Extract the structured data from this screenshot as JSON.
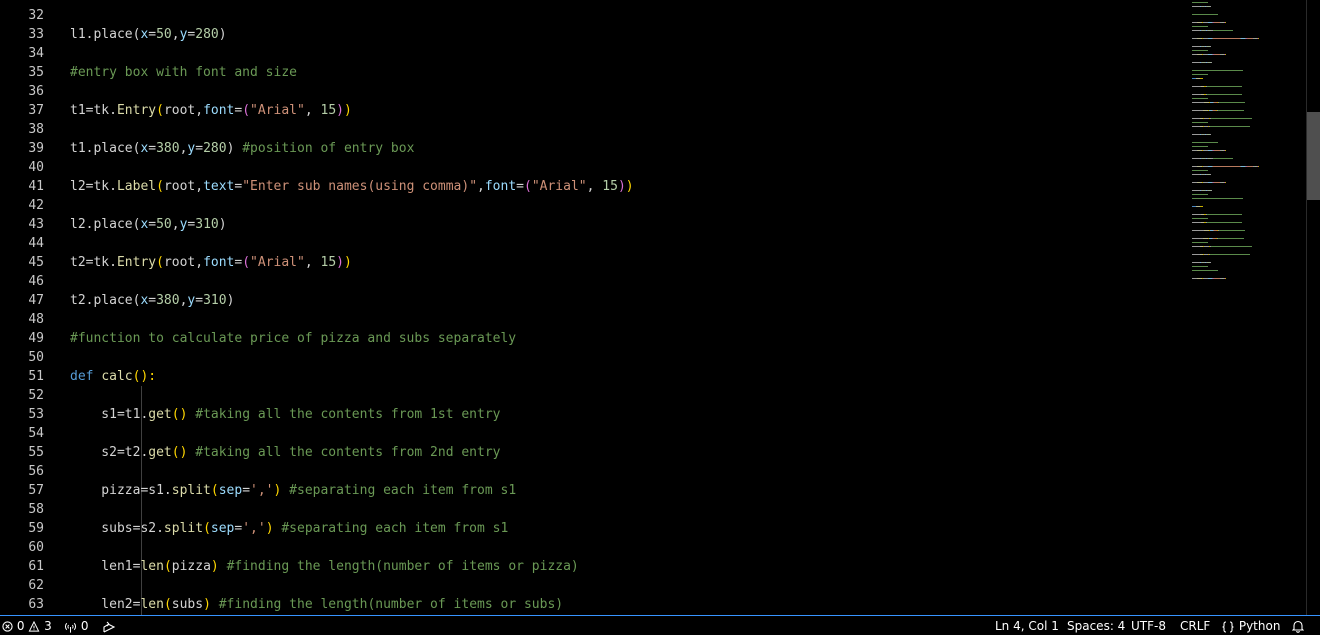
{
  "editor": {
    "line_numbers": [
      "32",
      "33",
      "34",
      "35",
      "36",
      "37",
      "38",
      "39",
      "40",
      "41",
      "42",
      "43",
      "44",
      "45",
      "46",
      "47",
      "48",
      "49",
      "50",
      "51",
      "52",
      "53",
      "54",
      "55",
      "56",
      "57",
      "58",
      "59",
      "60",
      "61",
      "62",
      "63"
    ],
    "lines": [
      [],
      [
        {
          "t": "l1.place(",
          "c": "tx"
        },
        {
          "t": "x",
          "c": "pa"
        },
        {
          "t": "=",
          "c": "tx"
        },
        {
          "t": "50",
          "c": "num"
        },
        {
          "t": ",",
          "c": "tx"
        },
        {
          "t": "y",
          "c": "pa"
        },
        {
          "t": "=",
          "c": "tx"
        },
        {
          "t": "280",
          "c": "num"
        },
        {
          "t": ")",
          "c": "tx"
        }
      ],
      [],
      [
        {
          "t": "#entry box with font and size",
          "c": "cm"
        }
      ],
      [],
      [
        {
          "t": "t1=tk.",
          "c": "tx"
        },
        {
          "t": "Entry",
          "c": "fn"
        },
        {
          "t": "(",
          "c": "br1"
        },
        {
          "t": "root,",
          "c": "tx"
        },
        {
          "t": "font",
          "c": "pa"
        },
        {
          "t": "=",
          "c": "tx"
        },
        {
          "t": "(",
          "c": "br2"
        },
        {
          "t": "\"Arial\"",
          "c": "str"
        },
        {
          "t": ", ",
          "c": "tx"
        },
        {
          "t": "15",
          "c": "num"
        },
        {
          "t": ")",
          "c": "br2"
        },
        {
          "t": ")",
          "c": "br1"
        }
      ],
      [],
      [
        {
          "t": "t1.place(",
          "c": "tx"
        },
        {
          "t": "x",
          "c": "pa"
        },
        {
          "t": "=",
          "c": "tx"
        },
        {
          "t": "380",
          "c": "num"
        },
        {
          "t": ",",
          "c": "tx"
        },
        {
          "t": "y",
          "c": "pa"
        },
        {
          "t": "=",
          "c": "tx"
        },
        {
          "t": "280",
          "c": "num"
        },
        {
          "t": ") ",
          "c": "tx"
        },
        {
          "t": "#position of entry box",
          "c": "cm"
        }
      ],
      [],
      [
        {
          "t": "l2=tk.",
          "c": "tx"
        },
        {
          "t": "Label",
          "c": "fn"
        },
        {
          "t": "(",
          "c": "br1"
        },
        {
          "t": "root,",
          "c": "tx"
        },
        {
          "t": "text",
          "c": "pa"
        },
        {
          "t": "=",
          "c": "tx"
        },
        {
          "t": "\"Enter sub names(using comma)\"",
          "c": "str"
        },
        {
          "t": ",",
          "c": "tx"
        },
        {
          "t": "font",
          "c": "pa"
        },
        {
          "t": "=",
          "c": "tx"
        },
        {
          "t": "(",
          "c": "br2"
        },
        {
          "t": "\"Arial\"",
          "c": "str"
        },
        {
          "t": ", ",
          "c": "tx"
        },
        {
          "t": "15",
          "c": "num"
        },
        {
          "t": ")",
          "c": "br2"
        },
        {
          "t": ")",
          "c": "br1"
        }
      ],
      [],
      [
        {
          "t": "l2.place(",
          "c": "tx"
        },
        {
          "t": "x",
          "c": "pa"
        },
        {
          "t": "=",
          "c": "tx"
        },
        {
          "t": "50",
          "c": "num"
        },
        {
          "t": ",",
          "c": "tx"
        },
        {
          "t": "y",
          "c": "pa"
        },
        {
          "t": "=",
          "c": "tx"
        },
        {
          "t": "310",
          "c": "num"
        },
        {
          "t": ")",
          "c": "tx"
        }
      ],
      [],
      [
        {
          "t": "t2=tk.",
          "c": "tx"
        },
        {
          "t": "Entry",
          "c": "fn"
        },
        {
          "t": "(",
          "c": "br1"
        },
        {
          "t": "root,",
          "c": "tx"
        },
        {
          "t": "font",
          "c": "pa"
        },
        {
          "t": "=",
          "c": "tx"
        },
        {
          "t": "(",
          "c": "br2"
        },
        {
          "t": "\"Arial\"",
          "c": "str"
        },
        {
          "t": ", ",
          "c": "tx"
        },
        {
          "t": "15",
          "c": "num"
        },
        {
          "t": ")",
          "c": "br2"
        },
        {
          "t": ")",
          "c": "br1"
        }
      ],
      [],
      [
        {
          "t": "t2.place(",
          "c": "tx"
        },
        {
          "t": "x",
          "c": "pa"
        },
        {
          "t": "=",
          "c": "tx"
        },
        {
          "t": "380",
          "c": "num"
        },
        {
          "t": ",",
          "c": "tx"
        },
        {
          "t": "y",
          "c": "pa"
        },
        {
          "t": "=",
          "c": "tx"
        },
        {
          "t": "310",
          "c": "num"
        },
        {
          "t": ")",
          "c": "tx"
        }
      ],
      [],
      [
        {
          "t": "#function to calculate price of pizza and subs separately",
          "c": "cm"
        }
      ],
      [],
      [
        {
          "t": "def ",
          "c": "kw"
        },
        {
          "t": "calc",
          "c": "fn"
        },
        {
          "t": "():",
          "c": "br1"
        }
      ],
      [],
      [
        {
          "t": "    s1=t1.",
          "c": "tx"
        },
        {
          "t": "get",
          "c": "fn"
        },
        {
          "t": "()",
          "c": "br1"
        },
        {
          "t": " ",
          "c": "tx"
        },
        {
          "t": "#taking all the contents from 1st entry",
          "c": "cm"
        }
      ],
      [],
      [
        {
          "t": "    s2=t2.",
          "c": "tx"
        },
        {
          "t": "get",
          "c": "fn"
        },
        {
          "t": "()",
          "c": "br1"
        },
        {
          "t": " ",
          "c": "tx"
        },
        {
          "t": "#taking all the contents from 2nd entry",
          "c": "cm"
        }
      ],
      [],
      [
        {
          "t": "    pizza=s1.",
          "c": "tx"
        },
        {
          "t": "split",
          "c": "fn"
        },
        {
          "t": "(",
          "c": "br1"
        },
        {
          "t": "sep",
          "c": "pa"
        },
        {
          "t": "=",
          "c": "tx"
        },
        {
          "t": "','",
          "c": "str"
        },
        {
          "t": ")",
          "c": "br1"
        },
        {
          "t": " ",
          "c": "tx"
        },
        {
          "t": "#separating each item from s1",
          "c": "cm"
        }
      ],
      [],
      [
        {
          "t": "    subs=s2.",
          "c": "tx"
        },
        {
          "t": "split",
          "c": "fn"
        },
        {
          "t": "(",
          "c": "br1"
        },
        {
          "t": "sep",
          "c": "pa"
        },
        {
          "t": "=",
          "c": "tx"
        },
        {
          "t": "','",
          "c": "str"
        },
        {
          "t": ")",
          "c": "br1"
        },
        {
          "t": " ",
          "c": "tx"
        },
        {
          "t": "#separating each item from s1",
          "c": "cm"
        }
      ],
      [],
      [
        {
          "t": "    len1=",
          "c": "tx"
        },
        {
          "t": "len",
          "c": "fn"
        },
        {
          "t": "(",
          "c": "br1"
        },
        {
          "t": "pizza",
          "c": "tx"
        },
        {
          "t": ")",
          "c": "br1"
        },
        {
          "t": " ",
          "c": "tx"
        },
        {
          "t": "#finding the length(number of items or pizza)",
          "c": "cm"
        }
      ],
      [],
      [
        {
          "t": "    len2=",
          "c": "tx"
        },
        {
          "t": "len",
          "c": "fn"
        },
        {
          "t": "(",
          "c": "br1"
        },
        {
          "t": "subs",
          "c": "tx"
        },
        {
          "t": ")",
          "c": "br1"
        },
        {
          "t": " ",
          "c": "tx"
        },
        {
          "t": "#finding the length(number of items or subs)",
          "c": "cm"
        }
      ]
    ]
  },
  "colors": {
    "background": "#000000",
    "line_number": "#c8c8c8",
    "text": "#d4d4d4",
    "string": "#ce9178",
    "comment": "#6a9955",
    "number": "#b5cea8",
    "function": "#dcdcaa",
    "keyword": "#569cd6",
    "parameter": "#9cdcfe",
    "bracket_level_1": "#ffd700",
    "bracket_level_2": "#da70d6",
    "status_bar_border": "#3794ff"
  },
  "status_bar": {
    "errors_icon": "error-circle-icon",
    "errors_count": "0",
    "warnings_icon": "warning-triangle-icon",
    "warnings_count": "3",
    "ports_icon": "antenna-icon",
    "ports_count": "0",
    "live_share_icon": "live-share-icon",
    "cursor_position": "Ln 4, Col 1",
    "indentation": "Spaces: 4",
    "encoding": "UTF-8",
    "line_ending": "CRLF",
    "language_icon": "braces-icon",
    "language": "Python",
    "notifications_icon": "bell-icon"
  }
}
